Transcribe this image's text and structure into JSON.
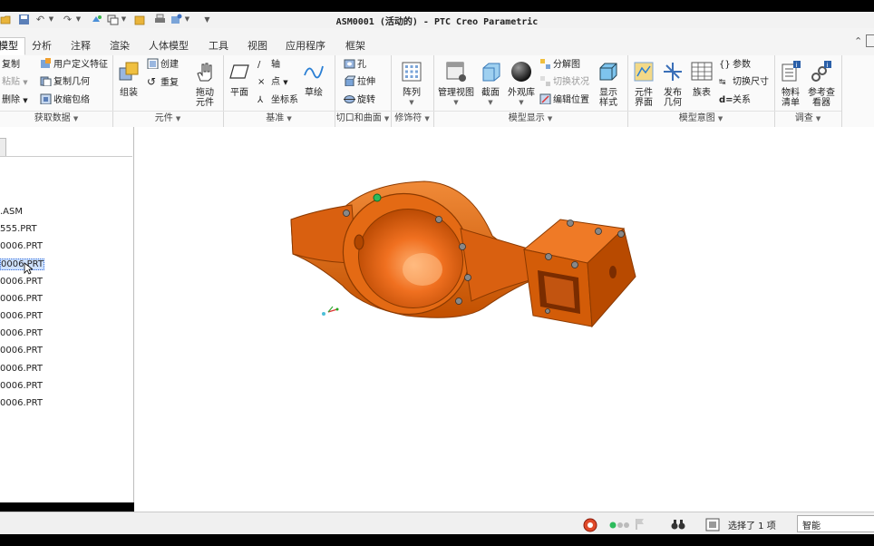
{
  "window": {
    "title": "ASM0001 (活动的) - PTC Creo Parametric"
  },
  "tabs": [
    "模型",
    "分析",
    "注释",
    "渲染",
    "人体模型",
    "工具",
    "视图",
    "应用程序",
    "框架"
  ],
  "ribbon": {
    "groups": {
      "get_data": {
        "label": "获取数据",
        "items": [
          "复制",
          "粘贴",
          "删除",
          "用户定义特征",
          "复制几何",
          "收缩包络"
        ]
      },
      "component": {
        "label": "元件",
        "assemble": "组装",
        "create": "创建",
        "repeat": "重复",
        "drag": "拖动元件"
      },
      "datum": {
        "label": "基准",
        "plane": "平面",
        "axis": "轴",
        "point": "点",
        "csys": "坐标系",
        "sketch": "草绘"
      },
      "cut_surface": {
        "label": "切口和曲面",
        "hole": "孔",
        "extrude": "拉伸",
        "revolve": "旋转"
      },
      "modifier": {
        "label": "修饰符",
        "pattern": "阵列"
      },
      "model_display": {
        "label": "模型显示",
        "manage_views": "管理视图",
        "section": "截面",
        "appearance": "外观库",
        "explode": "分解图",
        "toggle_status": "切换状况",
        "edit_position": "编辑位置",
        "display_style": "显示样式"
      },
      "model_intent": {
        "label": "模型意图",
        "component_interface": "元件界面",
        "publish_geometry": "发布几何",
        "family_table": "族表",
        "parameters": "参数",
        "switch_dimensions": "切换尺寸",
        "relations": "关系"
      },
      "investigate": {
        "label": "调查",
        "bom": "物料清单",
        "reference_viewer": "参考查看器"
      }
    }
  },
  "model_tree": {
    "items": [
      ".ASM",
      "555.PRT",
      "0006.PRT",
      "0006.PRT",
      "0006.PRT",
      "0006.PRT",
      "0006.PRT",
      "0006.PRT",
      "0006.PRT",
      "0006.PRT",
      "0006.PRT",
      "0006.PRT"
    ],
    "selected_index": 3
  },
  "status": {
    "selection": "选择了 1 项",
    "filter": "智能"
  },
  "colors": {
    "model_orange": "#e3640c",
    "model_dark": "#a83f00",
    "selection": "#cfe2ff"
  }
}
